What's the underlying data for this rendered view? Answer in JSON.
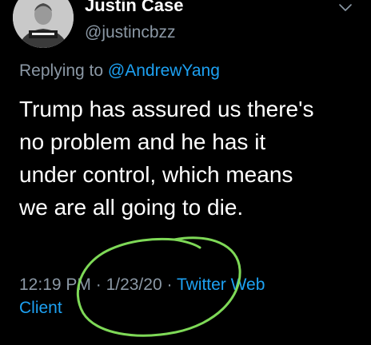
{
  "tweet": {
    "display_name": "Justin Case",
    "handle": "@justincbzz",
    "replying_prefix": "Replying to ",
    "replying_to": "@AndrewYang",
    "text_lines": [
      "Trump has assured us there's",
      "no problem and he has it",
      "under control, which means",
      "we are all going to die."
    ],
    "time": "12:19 PM",
    "date": "1/23/20",
    "separator": " · ",
    "source_line1": "Twitter Web",
    "source_line2": "Client"
  },
  "icons": {
    "menu": "chevron-down-icon"
  },
  "colors": {
    "background": "#000000",
    "text": "#ffffff",
    "secondary": "#8b98a5",
    "link": "#1da1f2",
    "annotation": "#7ed957"
  }
}
